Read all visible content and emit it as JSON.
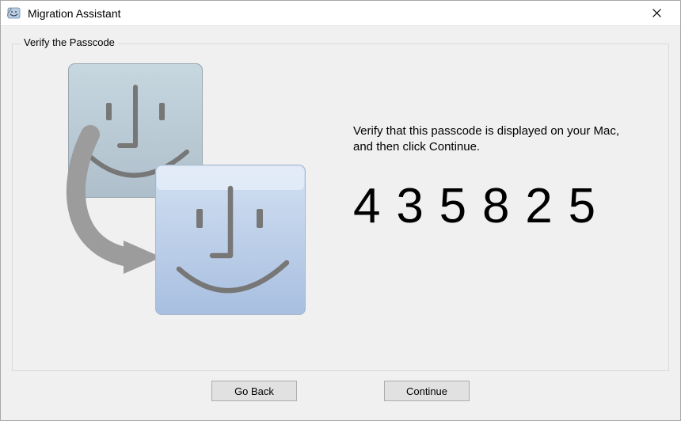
{
  "window": {
    "title": "Migration Assistant"
  },
  "group": {
    "label": "Verify the Passcode",
    "instruction": "Verify that this passcode is displayed on your Mac, and then click Continue.",
    "passcode": "435825"
  },
  "buttons": {
    "back": "Go Back",
    "continue": "Continue"
  },
  "icons": {
    "app": "migration-assistant-icon",
    "close": "close-icon"
  }
}
